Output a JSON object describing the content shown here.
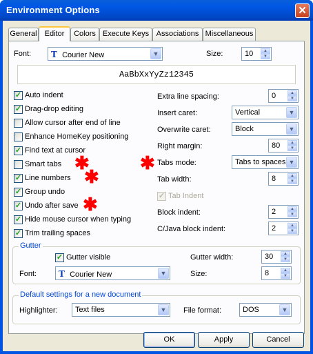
{
  "window": {
    "title": "Environment Options",
    "close_label": "✕"
  },
  "tabs": [
    "General",
    "Editor",
    "Colors",
    "Execute Keys",
    "Associations",
    "Miscellaneous"
  ],
  "font": {
    "label": "Font:",
    "value": "Courier New",
    "size_label": "Size:",
    "size": "10"
  },
  "preview_text": "AaBbXxYyZz12345",
  "checkboxes": [
    {
      "label": "Auto indent",
      "checked": true
    },
    {
      "label": "Drag-drop editing",
      "checked": true
    },
    {
      "label": "Allow cursor after end of line",
      "checked": false
    },
    {
      "label": "Enhance HomeKey positioning",
      "checked": false
    },
    {
      "label": "Find text at cursor",
      "checked": true
    },
    {
      "label": "Smart tabs",
      "checked": false
    },
    {
      "label": "Line numbers",
      "checked": true
    },
    {
      "label": "Group undo",
      "checked": true
    },
    {
      "label": "Undo after save",
      "checked": true
    },
    {
      "label": "Hide mouse cursor when typing",
      "checked": true
    },
    {
      "label": "Trim trailing spaces",
      "checked": true
    }
  ],
  "right": {
    "extra_spacing_label": "Extra line spacing:",
    "extra_spacing": "0",
    "insert_caret_label": "Insert caret:",
    "insert_caret": "Vertical",
    "overwrite_caret_label": "Overwrite caret:",
    "overwrite_caret": "Block",
    "right_margin_label": "Right margin:",
    "right_margin": "80",
    "tabs_mode_label": "Tabs mode:",
    "tabs_mode": "Tabs to spaces",
    "tab_width_label": "Tab width:",
    "tab_width": "8",
    "tab_indent_label": "Tab Indent",
    "block_indent_label": "Block indent:",
    "block_indent": "2",
    "cjava_indent_label": "C/Java block indent:",
    "cjava_indent": "2"
  },
  "gutter": {
    "caption": "Gutter",
    "visible_label": "Gutter visible",
    "font_label": "Font:",
    "font": "Courier New",
    "width_label": "Gutter width:",
    "width": "30",
    "size_label": "Size:",
    "size": "8"
  },
  "defaults": {
    "caption": "Default settings for a new document",
    "highlighter_label": "Highlighter:",
    "highlighter": "Text files",
    "format_label": "File format:",
    "format": "DOS"
  },
  "buttons": {
    "ok": "OK",
    "apply": "Apply",
    "cancel": "Cancel"
  },
  "annotation_marker": "✱",
  "colors": {
    "title_blue": "#0054e3",
    "accent": "#ffc83c",
    "group_caption": "#0046d5",
    "marker": "#ff0000"
  }
}
